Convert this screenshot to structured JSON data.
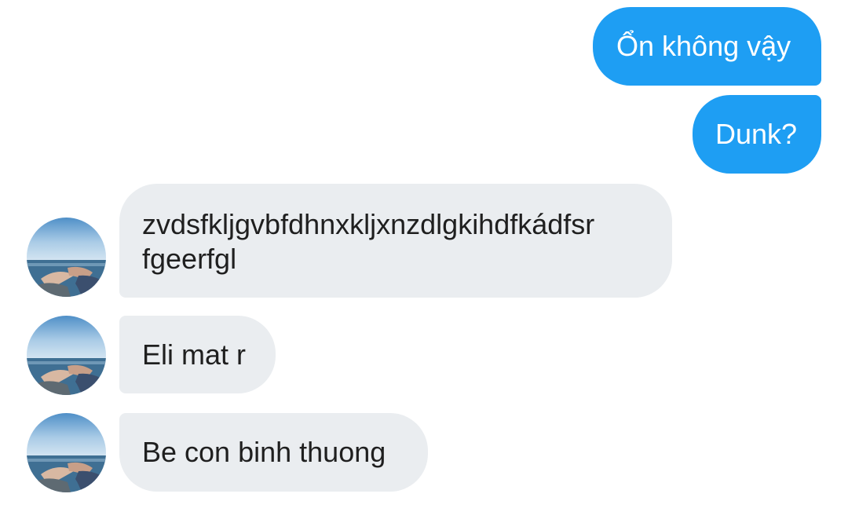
{
  "messages": {
    "sent": [
      {
        "text": "Ổn không vậy"
      },
      {
        "text": "Dunk?"
      }
    ],
    "received": [
      {
        "line1": "zvdsfkljgvbfdhnxkljxnzdlgkihdfkádfsr",
        "line2": "fgeerfgl"
      },
      {
        "text": "Eli mat r"
      },
      {
        "text": "Be con binh thuong"
      }
    ]
  },
  "colors": {
    "sent_bubble": "#1e9ef3",
    "received_bubble": "#eaedf0",
    "sent_text": "#ffffff",
    "received_text": "#1f1f1f"
  },
  "avatar": {
    "icon": "contact-avatar-photo"
  }
}
